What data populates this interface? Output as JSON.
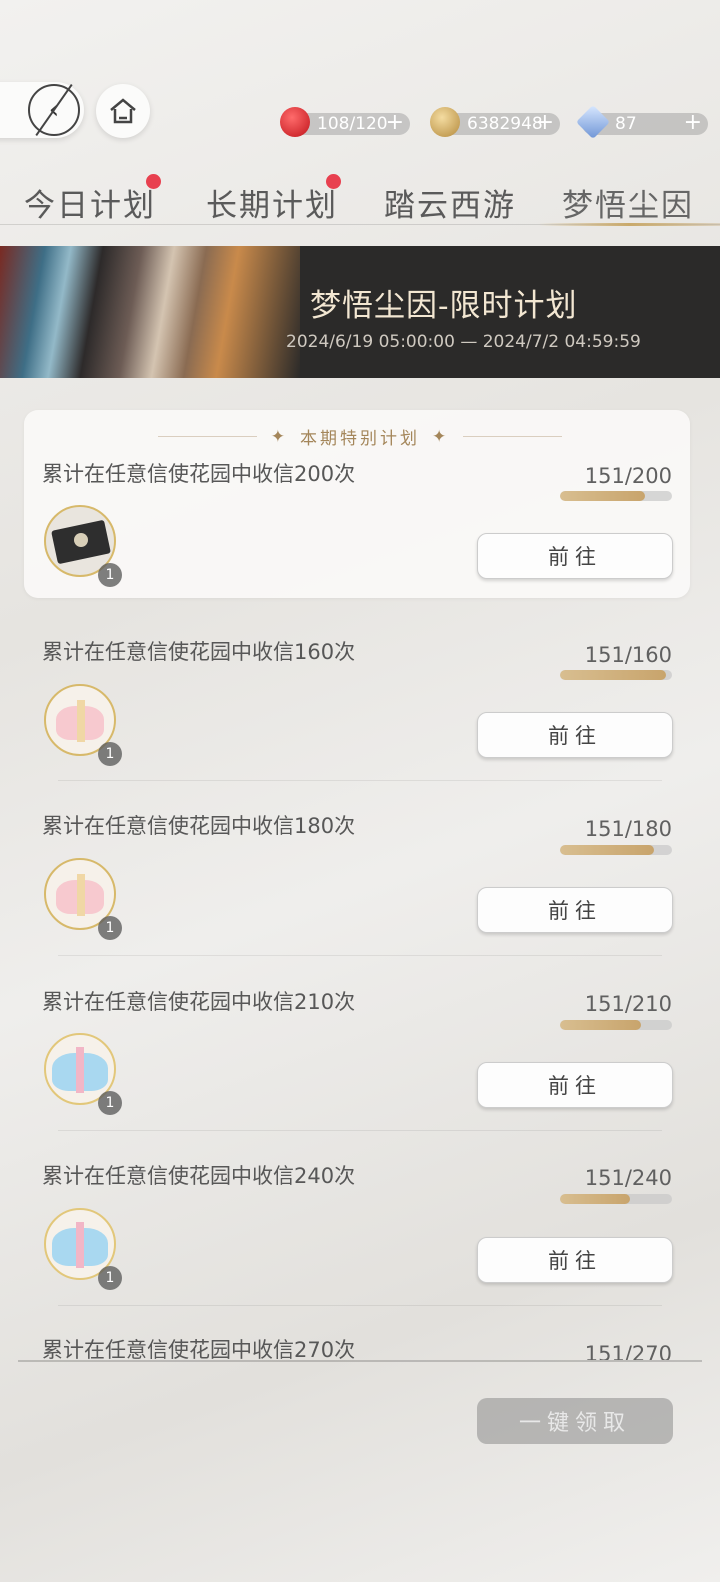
{
  "resources": [
    {
      "name": "apple",
      "value": "108/120",
      "plus": "+",
      "color": "#d7262c"
    },
    {
      "name": "coin",
      "value": "6382948",
      "plus": "+",
      "color": "#d8b16a"
    },
    {
      "name": "crystal",
      "value": "87",
      "plus": "+",
      "color": "#7fa6d8"
    }
  ],
  "tabs": [
    {
      "label": "今日计划",
      "badge": true
    },
    {
      "label": "长期计划",
      "badge": true
    },
    {
      "label": "踏云西游",
      "badge": false
    },
    {
      "label": "梦悟尘因",
      "badge": false,
      "active": true
    }
  ],
  "banner": {
    "title": "梦悟尘因-限时计划",
    "date": "2024/6/19 05:00:00 — 2024/7/2 04:59:59"
  },
  "special_header": "本期特别计划",
  "tasks": [
    {
      "title": "累计在任意信使花园中收信200次",
      "progress": "151/200",
      "fraction": 0.755,
      "reward": "black-box",
      "count": "1",
      "button": "前往"
    },
    {
      "title": "累计在任意信使花园中收信160次",
      "progress": "151/160",
      "fraction": 0.944,
      "reward": "pink-heart-box",
      "count": "1",
      "button": "前往"
    },
    {
      "title": "累计在任意信使花园中收信180次",
      "progress": "151/180",
      "fraction": 0.839,
      "reward": "pink-heart-box",
      "count": "1",
      "button": "前往"
    },
    {
      "title": "累计在任意信使花园中收信210次",
      "progress": "151/210",
      "fraction": 0.719,
      "reward": "blue-heart-box",
      "count": "1",
      "button": "前往"
    },
    {
      "title": "累计在任意信使花园中收信240次",
      "progress": "151/240",
      "fraction": 0.629,
      "reward": "blue-heart-box",
      "count": "1",
      "button": "前往"
    },
    {
      "title": "累计在任意信使花园中收信270次",
      "progress": "151/270",
      "fraction": 0.559
    }
  ],
  "collect_all": "一键领取"
}
